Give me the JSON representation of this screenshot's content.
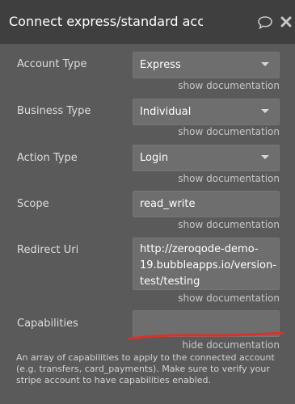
{
  "header": {
    "title": "Connect express/standard account",
    "comment_icon": "comment-icon",
    "close_icon": "close-icon"
  },
  "fields": {
    "account_type": {
      "label": "Account Type",
      "value": "Express",
      "doc_link": "show documentation"
    },
    "business_type": {
      "label": "Business Type",
      "value": "Individual",
      "doc_link": "show documentation"
    },
    "action_type": {
      "label": "Action Type",
      "value": "Login",
      "doc_link": "show documentation"
    },
    "scope": {
      "label": "Scope",
      "value": "read_write",
      "doc_link": "show documentation"
    },
    "redirect_uri": {
      "label": "Redirect Uri",
      "value": "http://zeroqode-demo-19.bubbleapps.io/version-test/testing",
      "doc_link": "show documentation"
    },
    "capabilities": {
      "label": "Capabilities",
      "value": "",
      "doc_link": "hide documentation",
      "description": "An array of capabilities to apply to the connected account (e.g. transfers, card_payments). Make sure to verify your stripe account to have capabilities enabled."
    }
  },
  "colors": {
    "panel_bg": "#5a5a5a",
    "header_bg": "#3f3f3f",
    "field_bg": "#6e6e6e",
    "annotation_red": "#d9322b"
  }
}
